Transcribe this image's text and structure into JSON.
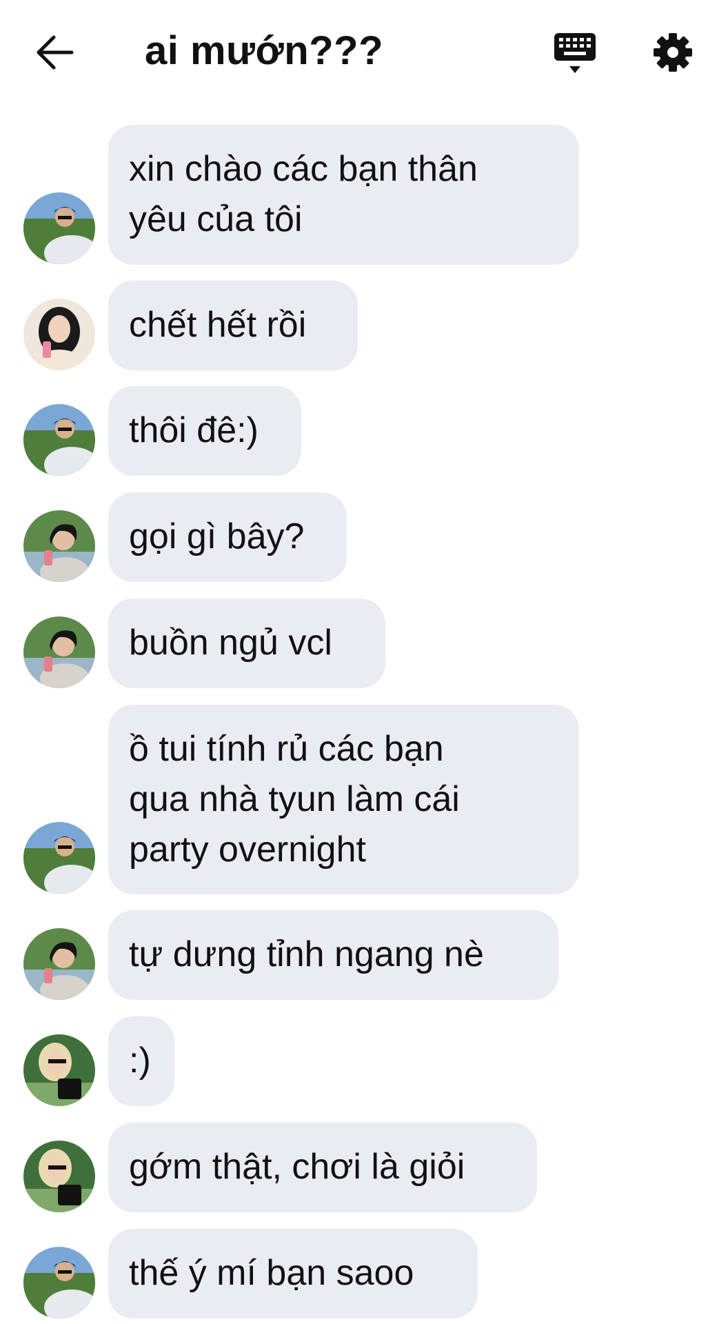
{
  "header": {
    "title": "ai mướn???",
    "back_icon": "arrow-left-icon",
    "keyboard_icon": "keyboard-icon",
    "settings_icon": "gear-icon"
  },
  "colors": {
    "bubble": "#e9ecf2",
    "background": "#ffffff",
    "text": "#111111"
  },
  "messages": [
    {
      "sender": "boy-sunglasses",
      "text": "xin chào các bạn thân\nyêu của tôi"
    },
    {
      "sender": "girl-pink-cup",
      "text": "chết hết rồi"
    },
    {
      "sender": "boy-sunglasses",
      "text": "thôi đê:)"
    },
    {
      "sender": "boy-dark-hair",
      "text": "gọi gì bây?"
    },
    {
      "sender": "boy-dark-hair",
      "text": "buồn ngủ vcl"
    },
    {
      "sender": "boy-sunglasses",
      "text": "ồ tui tính rủ các bạn\nqua nhà tyun làm cái\nparty overnight"
    },
    {
      "sender": "boy-dark-hair",
      "text": "tự dưng tỉnh ngang nè"
    },
    {
      "sender": "girl-sunglasses",
      "text": ":)"
    },
    {
      "sender": "girl-sunglasses",
      "text": "gớm thật, chơi là giỏi"
    },
    {
      "sender": "boy-sunglasses",
      "text": "thế ý mí bạn saoo"
    }
  ]
}
